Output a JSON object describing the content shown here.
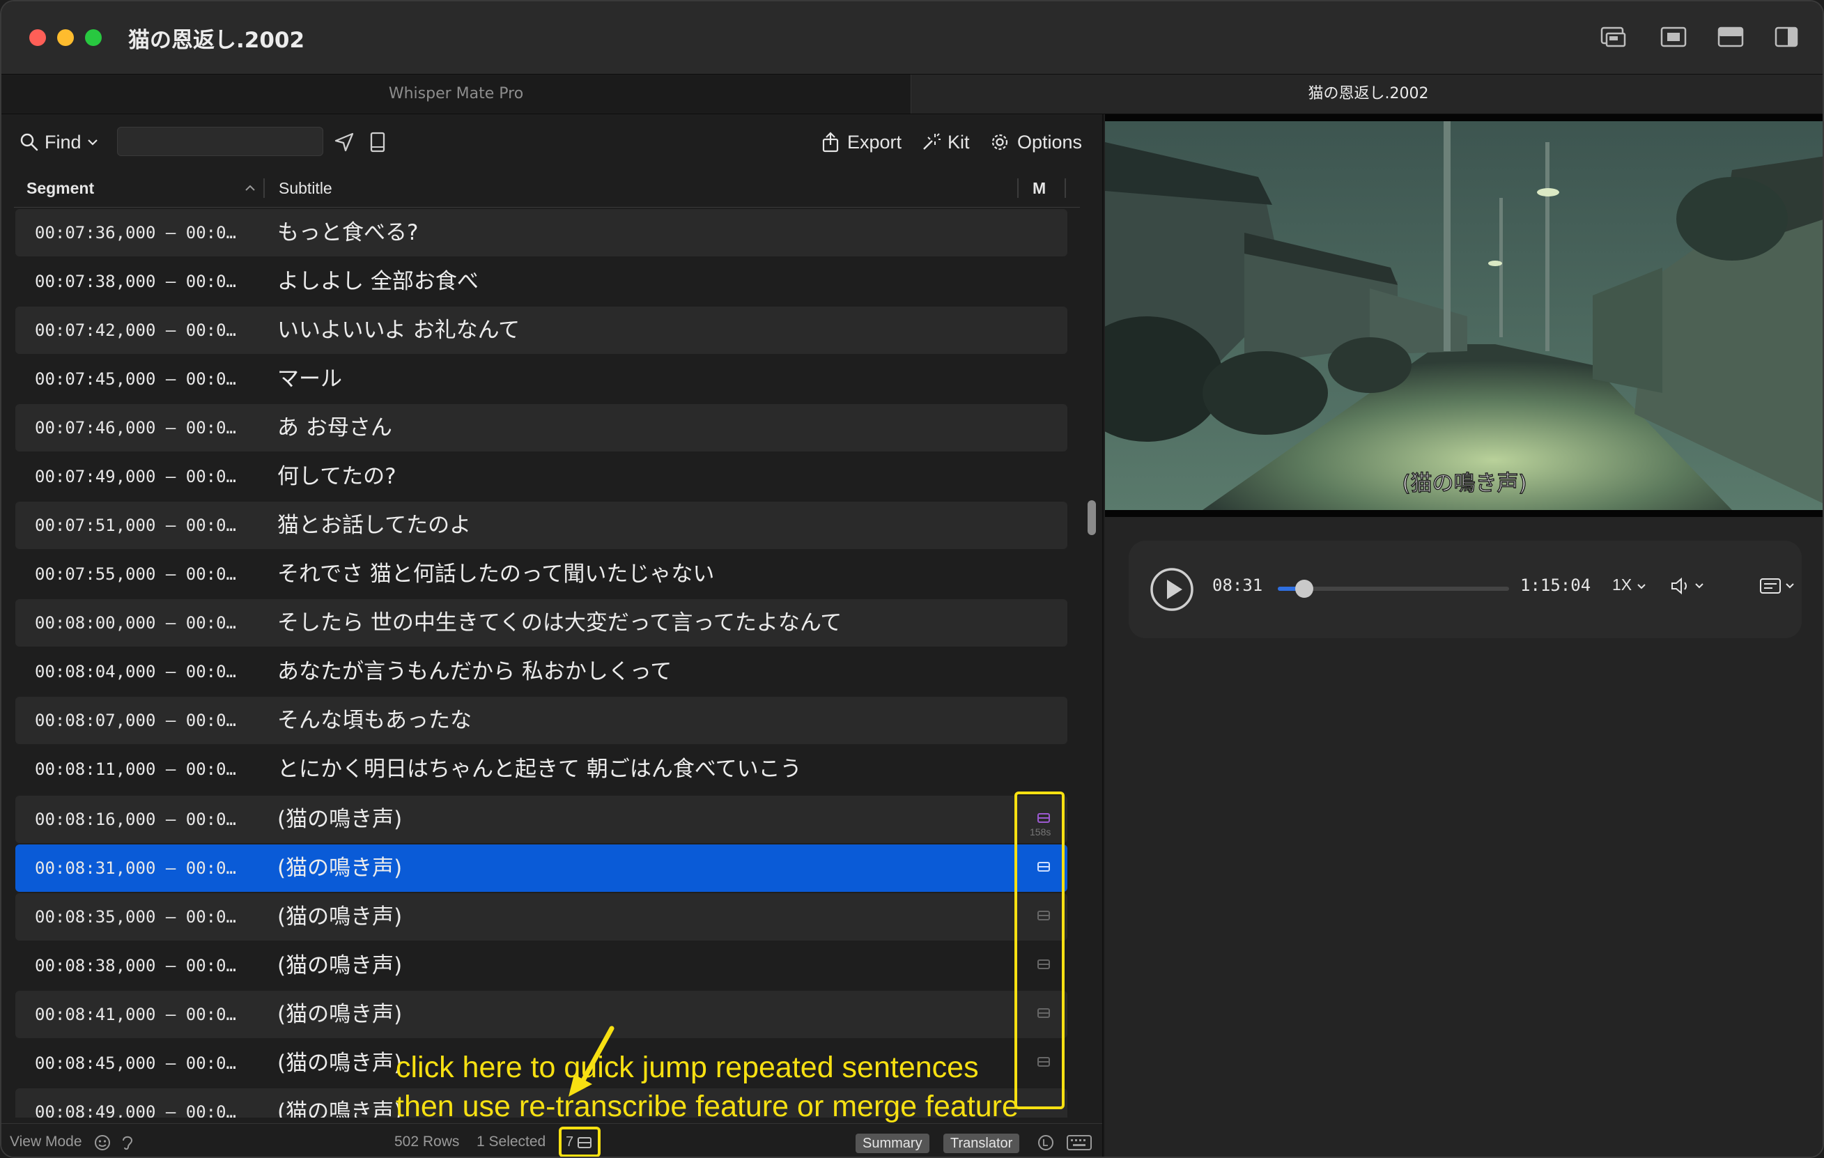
{
  "window": {
    "title": "猫の恩返し.2002"
  },
  "tabs": [
    {
      "label": "Whisper Mate Pro"
    },
    {
      "label": "猫の恩返し.2002"
    }
  ],
  "toolbar": {
    "find_label": "Find",
    "search_value": "",
    "export_label": "Export",
    "kit_label": "Kit",
    "options_label": "Options"
  },
  "columns": {
    "segment": "Segment",
    "subtitle": "Subtitle",
    "marker": "M"
  },
  "rows": [
    {
      "segment": "00:07:36,000 – 00:0…",
      "subtitle": "もっと食べる?"
    },
    {
      "segment": "00:07:38,000 – 00:0…",
      "subtitle": "よしよし 全部お食べ"
    },
    {
      "segment": "00:07:42,000 – 00:0…",
      "subtitle": "いいよいいよ お礼なんて"
    },
    {
      "segment": "00:07:45,000 – 00:0…",
      "subtitle": "マール"
    },
    {
      "segment": "00:07:46,000 – 00:0…",
      "subtitle": "あ お母さん"
    },
    {
      "segment": "00:07:49,000 – 00:0…",
      "subtitle": "何してたの?"
    },
    {
      "segment": "00:07:51,000 – 00:0…",
      "subtitle": "猫とお話してたのよ"
    },
    {
      "segment": "00:07:55,000 – 00:0…",
      "subtitle": "それでさ 猫と何話したのって聞いたじゃない"
    },
    {
      "segment": "00:08:00,000 – 00:0…",
      "subtitle": "そしたら 世の中生きてくのは大変だって言ってたよなんて"
    },
    {
      "segment": "00:08:04,000 – 00:0…",
      "subtitle": "あなたが言うもんだから 私おかしくって"
    },
    {
      "segment": "00:08:07,000 – 00:0…",
      "subtitle": "そんな頃もあったな"
    },
    {
      "segment": "00:08:11,000 – 00:0…",
      "subtitle": "とにかく明日はちゃんと起きて 朝ごはん食べていこう"
    },
    {
      "segment": "00:08:16,000 – 00:0…",
      "subtitle": "(猫の鳴き声)",
      "marker_count": "158s"
    },
    {
      "segment": "00:08:31,000 – 00:0…",
      "subtitle": "(猫の鳴き声)",
      "selected": true
    },
    {
      "segment": "00:08:35,000 – 00:0…",
      "subtitle": "(猫の鳴き声)"
    },
    {
      "segment": "00:08:38,000 – 00:0…",
      "subtitle": "(猫の鳴き声)"
    },
    {
      "segment": "00:08:41,000 – 00:0…",
      "subtitle": "(猫の鳴き声)"
    },
    {
      "segment": "00:08:45,000 – 00:0…",
      "subtitle": "(猫の鳴き声)"
    },
    {
      "segment": "00:08:49,000 – 00:0…",
      "subtitle": "(猫の鳴き声)"
    }
  ],
  "statusbar": {
    "view_mode": "View Mode",
    "rows_count": "502 Rows",
    "selected": "1 Selected",
    "repeat_count": "7",
    "summary_label": "Summary",
    "translator_label": "Translator"
  },
  "annotation": {
    "line1": "click here to quick jump repeated sentences",
    "line2": "then use re-transcribe feature or merge feature"
  },
  "video": {
    "caption": "(猫の鳴き声)"
  },
  "player": {
    "current_time": "08:31",
    "total_time": "1:15:04",
    "speed": "1X",
    "progress": 0.113
  },
  "colors": {
    "accent": "#0a5bd7",
    "annotation": "#f7e012",
    "marker_purple": "#9b59d0"
  }
}
